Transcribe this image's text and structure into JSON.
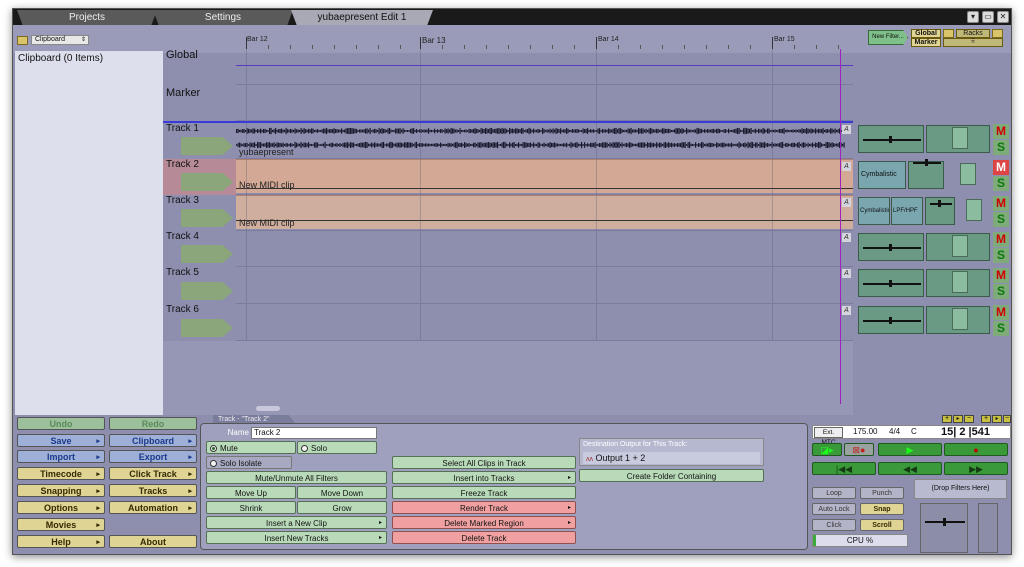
{
  "tabs": [
    {
      "label": "Projects"
    },
    {
      "label": "Settings"
    },
    {
      "label": "yubaepresent Edit 1"
    }
  ],
  "window_controls": {
    "menu": "▾",
    "restore": "▭",
    "close": "✕"
  },
  "header": {
    "clip_selector": "Clipboard",
    "bars": [
      "Bar 12",
      "Bar 13",
      "Bar 14",
      "Bar 15"
    ],
    "new_filter": "New Filter...",
    "global_label": "Global",
    "racks_label": "Racks",
    "marker_label": "Marker"
  },
  "clipboard": {
    "title": "Clipboard (0 Items)"
  },
  "lanes": {
    "global": "Global",
    "marker": "Marker"
  },
  "tracks": [
    {
      "name": "Track 1",
      "clip": "yubaepresent",
      "type": "audio"
    },
    {
      "name": "Track 2",
      "clip": "New MIDI clip",
      "type": "midi",
      "filter": "Cymbalistic"
    },
    {
      "name": "Track 3",
      "clip": "New MIDI clip",
      "type": "midi",
      "filter": "Cymbalistic",
      "filter2": "LPF/HPF"
    },
    {
      "name": "Track 4",
      "clip": "",
      "type": "empty"
    },
    {
      "name": "Track 5",
      "clip": "",
      "type": "empty"
    },
    {
      "name": "Track 6",
      "clip": "",
      "type": "empty"
    }
  ],
  "rack_labels": {
    "mute": "M",
    "solo": "S",
    "auto": "A"
  },
  "left_buttons": {
    "undo": "Undo",
    "redo": "Redo",
    "save": "Save",
    "clipboard": "Clipboard",
    "import": "Import",
    "export": "Export",
    "timecode": "Timecode",
    "click_track": "Click Track",
    "snapping": "Snapping",
    "tracks": "Tracks",
    "options": "Options",
    "automation": "Automation",
    "movies": "Movies",
    "help": "Help",
    "about": "About"
  },
  "track_panel": {
    "tab_title": "Track - \"Track 2\"",
    "name_label": "Name",
    "name_value": "Track 2",
    "mute": "Mute",
    "solo": "Solo",
    "solo_isolate": "Solo Isolate",
    "mute_unmute_filters": "Mute/Unmute All Filters",
    "move_up": "Move Up",
    "move_down": "Move Down",
    "shrink": "Shrink",
    "grow": "Grow",
    "insert_clip": "Insert a New Clip",
    "insert_tracks": "Insert New Tracks",
    "select_all_clips": "Select All Clips in Track",
    "insert_into_tracks": "Insert into Tracks",
    "freeze_track": "Freeze Track",
    "render_track": "Render Track",
    "delete_marked_region": "Delete Marked Region",
    "delete_track": "Delete Track",
    "destination_label": "Destination Output for This Track:",
    "destination_value": "Output 1 + 2",
    "create_folder": "Create Folder Containing"
  },
  "transport": {
    "ext_mtc": "Ext. MTC",
    "tempo": "175.00",
    "time_sig": "4/4",
    "key": "C",
    "position": "15| 2 |541",
    "loop": "Loop",
    "punch": "Punch",
    "auto_lock": "Auto Lock",
    "snap": "Snap",
    "click": "Click",
    "scroll": "Scroll",
    "cpu": "CPU %",
    "drop_filters": "(Drop Filters Here)"
  },
  "colors": {
    "background": "#8e8fae",
    "midi_clip": "#d3a996",
    "playhead": "#a020c0",
    "mute_red": "#d10000",
    "solo_green": "#0a7a0a"
  }
}
